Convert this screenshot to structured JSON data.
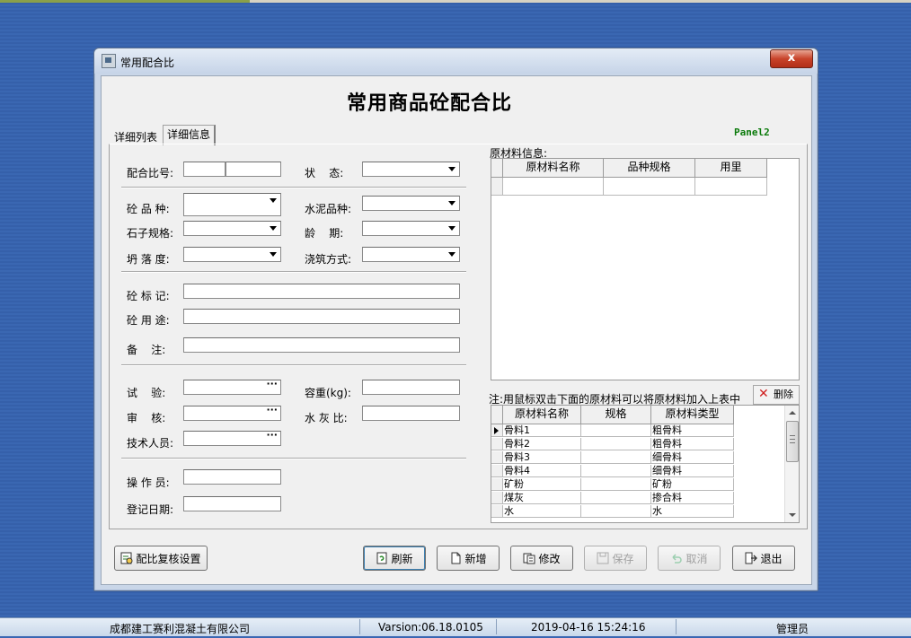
{
  "window": {
    "title": "常用配合比",
    "close_label": "x"
  },
  "heading": "常用商品砼配合比",
  "panel_label": "Panel2",
  "tabs": [
    {
      "label": "详细列表"
    },
    {
      "label": "详细信息"
    }
  ],
  "form": {
    "mix_no_label": "配合比号:",
    "status_label": "状    态:",
    "concrete_type_label": "砼 品 种:",
    "cement_type_label": "水泥品种:",
    "stone_spec_label": "石子规格:",
    "age_label": "龄    期:",
    "slump_label": "坍 落 度:",
    "pour_method_label": "浇筑方式:",
    "concrete_mark_label": "砼 标 记:",
    "concrete_use_label": "砼 用 途:",
    "remarks_label": "备    注:",
    "test_label": "试    验:",
    "density_label": "容重(kg):",
    "review_label": "审    核:",
    "wc_ratio_label": "水 灰 比:",
    "technician_label": "技术人员:",
    "operator_label": "操 作 员:",
    "reg_date_label": "登记日期:",
    "ellipsis": "···"
  },
  "raw_material": {
    "title": "原材料信息:",
    "columns": [
      "原材料名称",
      "品种规格",
      "用里"
    ]
  },
  "note": "注:用鼠标双击下面的原材料可以将原材料加入上表中",
  "delete_button": "删除",
  "material_list": {
    "columns": [
      "原材料名称",
      "规格",
      "原材料类型"
    ],
    "rows": [
      {
        "name": "骨料1",
        "spec": "",
        "type": "粗骨料",
        "current": true
      },
      {
        "name": "骨料2",
        "spec": "",
        "type": "粗骨料"
      },
      {
        "name": "骨料3",
        "spec": "",
        "type": "细骨料"
      },
      {
        "name": "骨料4",
        "spec": "",
        "type": "细骨料"
      },
      {
        "name": "矿粉",
        "spec": "",
        "type": "矿粉"
      },
      {
        "name": "煤灰",
        "spec": "",
        "type": "掺合料"
      },
      {
        "name": "水",
        "spec": "",
        "type": "水"
      }
    ]
  },
  "buttons": {
    "review_settings": "配比复核设置",
    "refresh": "刷新",
    "new": "新增",
    "modify": "修改",
    "save": "保存",
    "cancel": "取消",
    "exit": "退出"
  },
  "statusbar": {
    "company": "成都建工赛利混凝土有限公司",
    "version": "Varsion:06.18.0105",
    "datetime": "2019-04-16 15:24:16",
    "user": "管理员"
  }
}
